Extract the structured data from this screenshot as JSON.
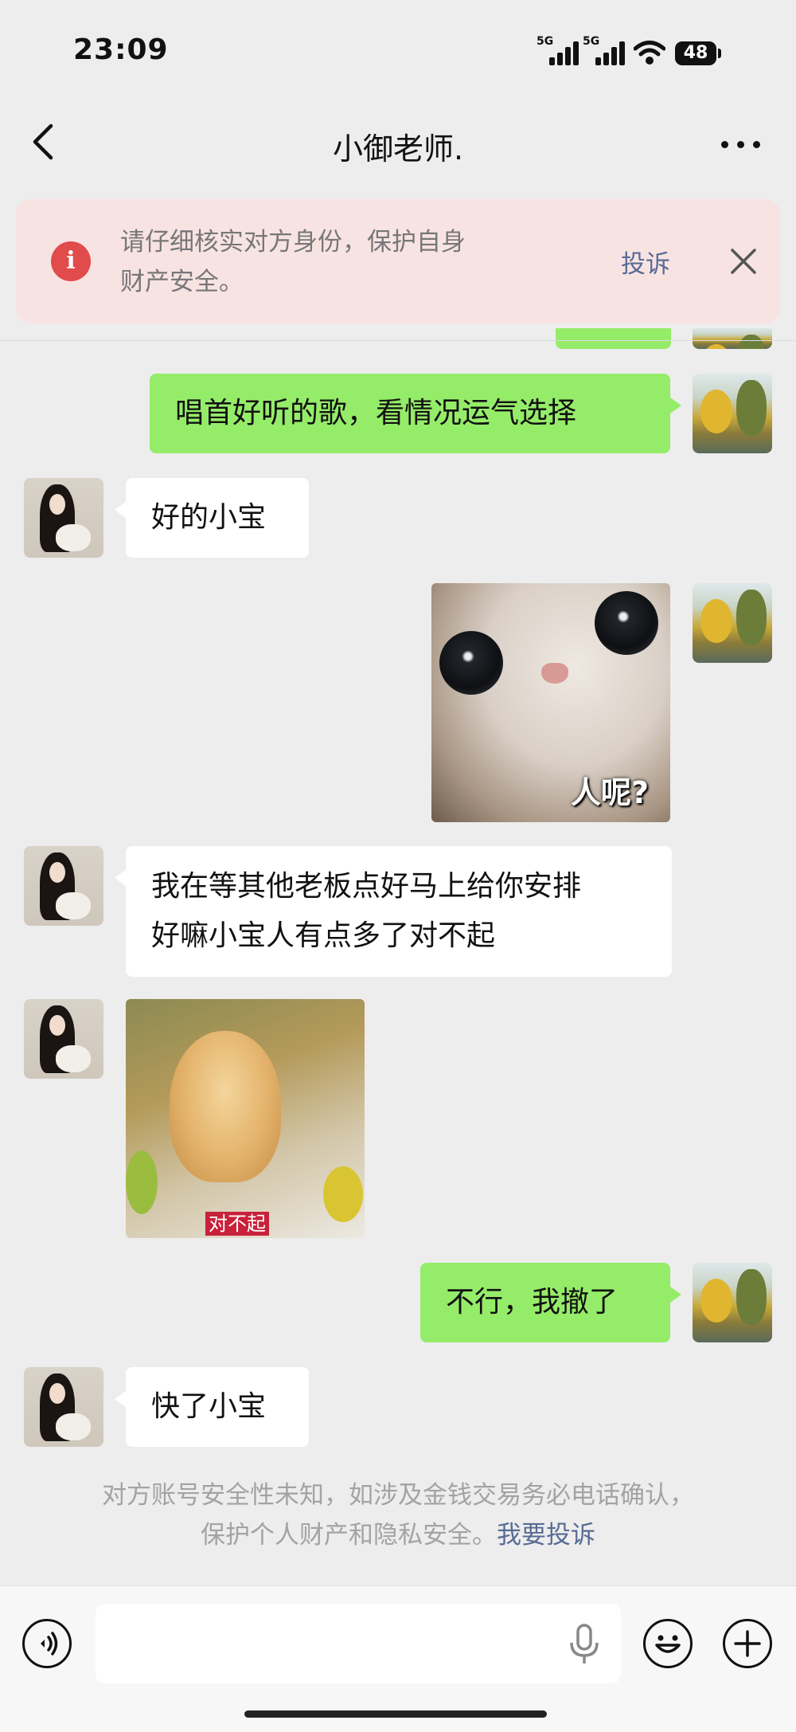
{
  "status_bar": {
    "time": "23:09",
    "network1": "5G",
    "network2": "5G",
    "battery": "48"
  },
  "header": {
    "title": "小御老师."
  },
  "banner": {
    "text": "请仔细核实对方身份，保护自身财产安全。",
    "report_label": "投诉"
  },
  "messages": [
    {
      "from": "me",
      "type": "text",
      "text": "唱首好听的歌，看情况运气选择"
    },
    {
      "from": "her",
      "type": "text",
      "text": "好的小宝"
    },
    {
      "from": "me",
      "type": "sticker",
      "caption": "人呢?"
    },
    {
      "from": "her",
      "type": "text",
      "lines": [
        "我在等其他老板点好马上给你安排",
        "好嘛小宝人有点多了对不起"
      ]
    },
    {
      "from": "her",
      "type": "sticker",
      "caption": "对不起"
    },
    {
      "from": "me",
      "type": "text",
      "text": "不行，我撤了"
    },
    {
      "from": "her",
      "type": "text",
      "text": "快了小宝"
    }
  ],
  "notice": {
    "line1": "对方账号安全性未知，如涉及金钱交易务必电话确认，",
    "line2": "保护个人财产和隐私安全。",
    "link": "我要投诉"
  },
  "input_bar": {
    "placeholder": ""
  },
  "icons": [
    "back-icon",
    "more-icon",
    "warning-icon",
    "close-icon",
    "voice-icon",
    "mic-icon",
    "emoji-icon",
    "plus-icon"
  ],
  "colors": {
    "my_bubble": "#95ec69",
    "her_bubble": "#ffffff",
    "background": "#ededed",
    "link": "#586b95",
    "warning": "#e24b4b"
  }
}
